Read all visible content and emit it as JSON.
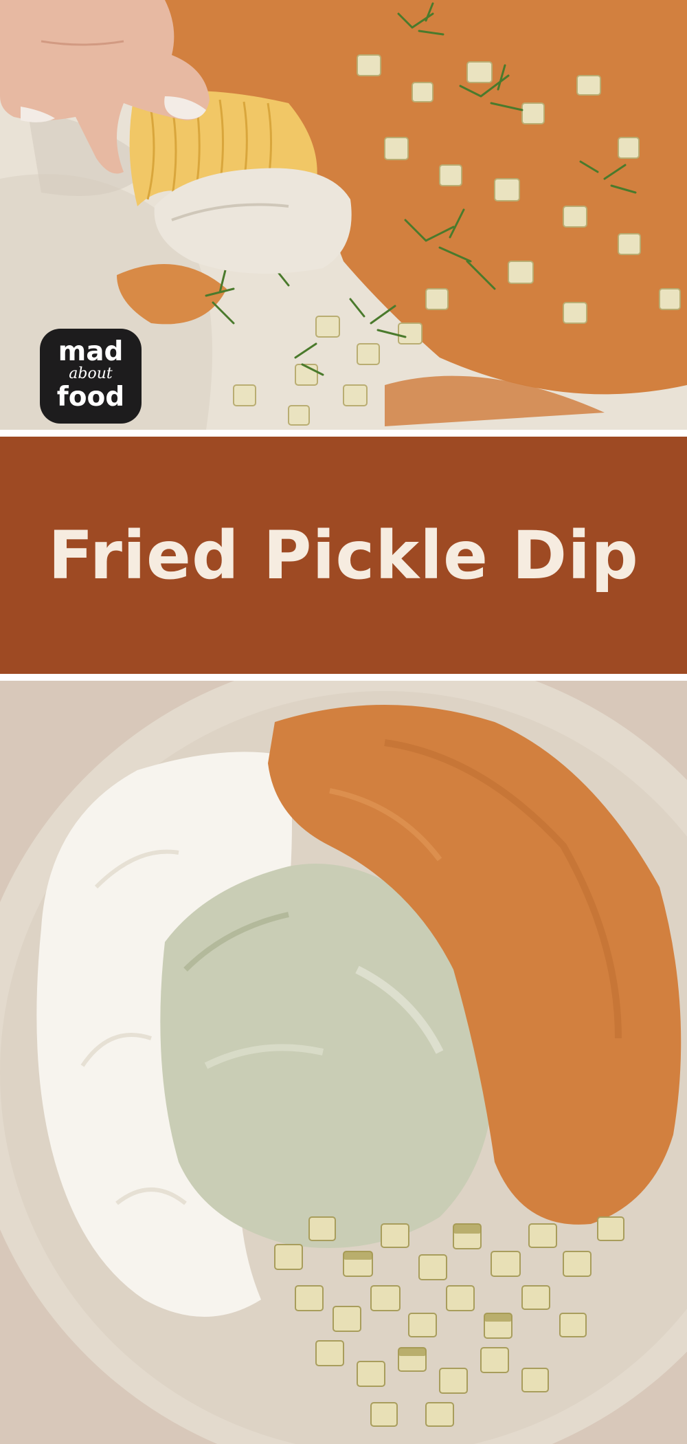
{
  "title": "Fried Pickle Dip",
  "logo": {
    "line1": "mad",
    "line2": "about",
    "line3": "food"
  },
  "colors": {
    "band": "#9e4a23",
    "title_text": "#f6ece0",
    "crumbs": "#d2803f",
    "dip": "#e9e2d6",
    "sour_cream": "#f7f4ee",
    "ranch_seasoning": "#c9cdb5",
    "pickle": "#e8e0b6",
    "bowl": "#e3dacd",
    "background": "#d8c8ba",
    "dill": "#4a7a2c",
    "chip": "#f1c766"
  },
  "images": {
    "top": "hand-dipping-chip-into-fried-pickle-dip-icon",
    "bottom": "bowl-of-dip-ingredients-icon"
  }
}
